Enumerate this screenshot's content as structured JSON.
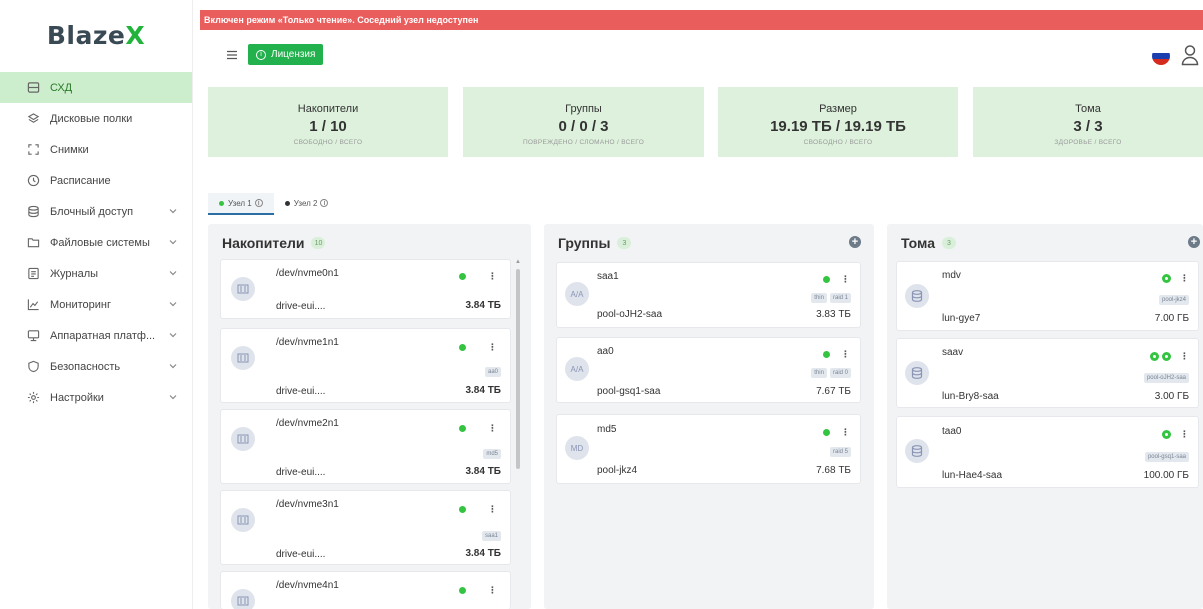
{
  "brand": {
    "name_main": "Blaze",
    "name_accent": "X"
  },
  "alert": {
    "text": "Включен режим «Только чтение». Соседний узел недоступен"
  },
  "topbar": {
    "license_label": "Лицензия"
  },
  "sidebar": {
    "items": [
      {
        "label": "СХД",
        "icon": "storage-icon",
        "active": true
      },
      {
        "label": "Дисковые полки",
        "icon": "shelves-icon"
      },
      {
        "label": "Снимки",
        "icon": "snapshot-icon"
      },
      {
        "label": "Расписание",
        "icon": "clock-icon"
      },
      {
        "label": "Блочный доступ",
        "icon": "database-icon",
        "expandable": true
      },
      {
        "label": "Файловые системы",
        "icon": "folder-icon",
        "expandable": true
      },
      {
        "label": "Журналы",
        "icon": "log-icon",
        "expandable": true
      },
      {
        "label": "Мониторинг",
        "icon": "chart-icon",
        "expandable": true
      },
      {
        "label": "Аппаратная платф...",
        "icon": "hardware-icon",
        "expandable": true
      },
      {
        "label": "Безопасность",
        "icon": "shield-icon",
        "expandable": true
      },
      {
        "label": "Настройки",
        "icon": "gear-icon",
        "expandable": true
      }
    ]
  },
  "stats": [
    {
      "title": "Накопители",
      "value": "1 / 10",
      "caption": "СВОБОДНО / ВСЕГО"
    },
    {
      "title": "Группы",
      "value": "0 / 0 / 3",
      "caption": "ПОВРЕЖДЕНО / СЛОМАНО / ВСЕГО"
    },
    {
      "title": "Размер",
      "value": "19.19 ТБ / 19.19 ТБ",
      "caption": "СВОБОДНО / ВСЕГО"
    },
    {
      "title": "Тома",
      "value": "3 / 3",
      "caption": "ЗДОРОВЬЕ / ВСЕГО"
    }
  ],
  "nodes": [
    {
      "label": "Узел 1",
      "status_color": "#34c442",
      "active": true
    },
    {
      "label": "Узел 2",
      "status_color": "#333333",
      "active": false
    }
  ],
  "drives": {
    "title": "Накопители",
    "count": "10",
    "items": [
      {
        "name": "/dev/nvme0n1",
        "sub": "drive-eui....",
        "size": "3.84 ТБ",
        "tag": ""
      },
      {
        "name": "/dev/nvme1n1",
        "sub": "drive-eui....",
        "size": "3.84 ТБ",
        "tag": "aa0"
      },
      {
        "name": "/dev/nvme2n1",
        "sub": "drive-eui....",
        "size": "3.84 ТБ",
        "tag": "md5"
      },
      {
        "name": "/dev/nvme3n1",
        "sub": "drive-eui....",
        "size": "3.84 ТБ",
        "tag": "saa1"
      },
      {
        "name": "/dev/nvme4n1",
        "sub": "",
        "size": "",
        "tag": ""
      }
    ]
  },
  "groups": {
    "title": "Группы",
    "count": "3",
    "items": [
      {
        "name": "saa1",
        "avatar": "A/A",
        "pool": "pool-oJH2-saa",
        "size": "3.83 ТБ",
        "tags": [
          "thin",
          "raid 1"
        ]
      },
      {
        "name": "aa0",
        "avatar": "A/A",
        "pool": "pool-gsq1-saa",
        "size": "7.67 ТБ",
        "tags": [
          "thin",
          "raid 0"
        ]
      },
      {
        "name": "md5",
        "avatar": "MD",
        "pool": "pool-jkz4",
        "size": "7.68 ТБ",
        "tags": [
          "raid 5"
        ]
      }
    ]
  },
  "volumes": {
    "title": "Тома",
    "count": "3",
    "items": [
      {
        "name": "mdv",
        "lun": "lun-gye7",
        "size": "7.00 ГБ",
        "tag": "pool-jkz4"
      },
      {
        "name": "saav",
        "lun": "lun-Bry8-saa",
        "size": "3.00 ГБ",
        "tag": "pool-oJH2-saa"
      },
      {
        "name": "taa0",
        "lun": "lun-Hae4-saa",
        "size": "100.00 ГБ",
        "tag": "pool-gsq1-saa"
      }
    ]
  }
}
